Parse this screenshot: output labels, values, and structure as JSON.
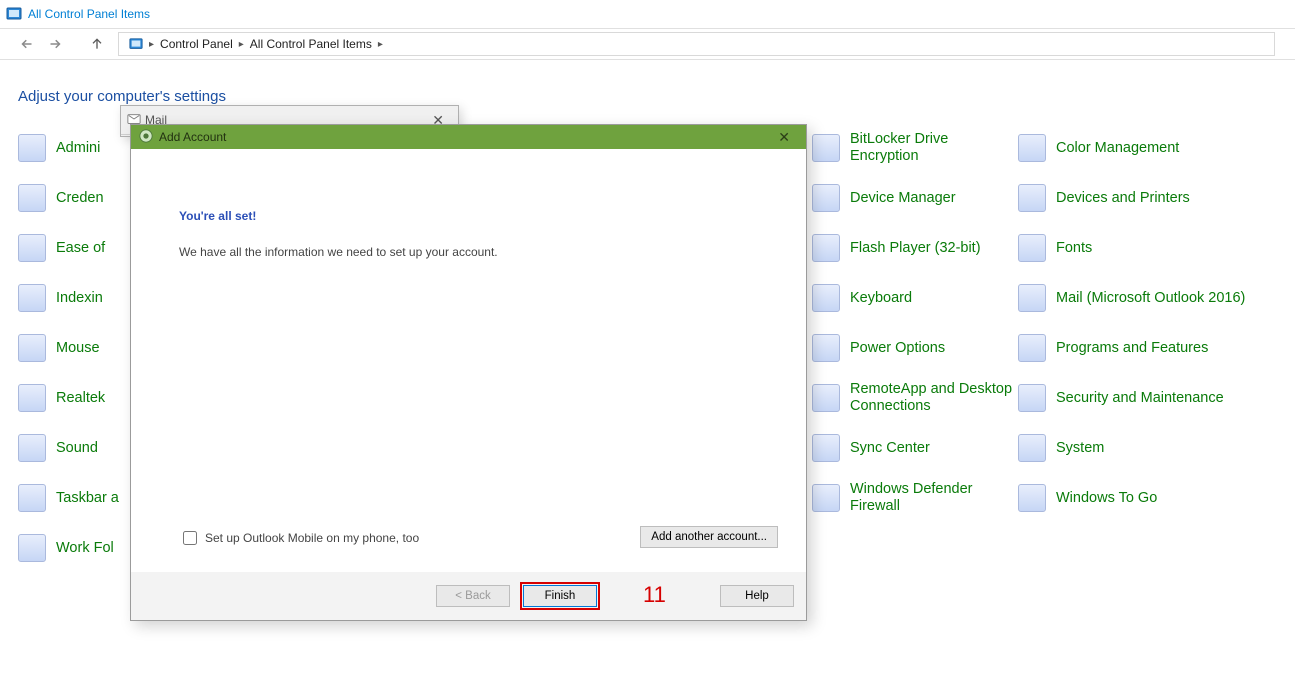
{
  "window": {
    "title": "All Control Panel Items"
  },
  "breadcrumb": {
    "segments": [
      "Control Panel",
      "All Control Panel Items"
    ]
  },
  "heading": "Adjust your computer's settings",
  "columns": {
    "c1": [
      {
        "name": "administrative-tools",
        "label": "Admini"
      },
      {
        "name": "credential-manager",
        "label": "Creden"
      },
      {
        "name": "ease-of-access",
        "label": "Ease of"
      },
      {
        "name": "indexing-options",
        "label": "Indexin"
      },
      {
        "name": "mouse",
        "label": "Mouse"
      },
      {
        "name": "realtek-audio",
        "label": "Realtek"
      },
      {
        "name": "sound",
        "label": "Sound"
      },
      {
        "name": "taskbar-and-navigation",
        "label": "Taskbar a"
      },
      {
        "name": "work-folders",
        "label": "Work Fol"
      }
    ],
    "c4": [
      {
        "name": "bitlocker",
        "label": "BitLocker Drive Encryption"
      },
      {
        "name": "device-manager",
        "label": "Device Manager"
      },
      {
        "name": "flash-player",
        "label": "Flash Player (32-bit)"
      },
      {
        "name": "keyboard",
        "label": "Keyboard"
      },
      {
        "name": "power-options",
        "label": "Power Options"
      },
      {
        "name": "remoteapp",
        "label": "RemoteApp and Desktop Connections"
      },
      {
        "name": "sync-center",
        "label": "Sync Center"
      },
      {
        "name": "windows-defender-firewall",
        "label": "Windows Defender Firewall"
      }
    ],
    "c5": [
      {
        "name": "color-management",
        "label": "Color Management"
      },
      {
        "name": "devices-and-printers",
        "label": "Devices and Printers"
      },
      {
        "name": "fonts",
        "label": "Fonts"
      },
      {
        "name": "mail-outlook-2016",
        "label": "Mail (Microsoft Outlook 2016)"
      },
      {
        "name": "programs-and-features",
        "label": "Programs and Features"
      },
      {
        "name": "security-and-maintenance",
        "label": "Security and Maintenance"
      },
      {
        "name": "system",
        "label": "System"
      },
      {
        "name": "windows-to-go",
        "label": "Windows To Go"
      }
    ]
  },
  "mail_window": {
    "title": "Mail"
  },
  "dialog": {
    "title": "Add Account",
    "headline": "You're all set!",
    "subtext": "We have all the information we need to set up your account.",
    "checkbox_label": "Set up Outlook Mobile on my phone, too",
    "add_another": "Add another account...",
    "back": "< Back",
    "finish": "Finish",
    "help": "Help"
  },
  "annotation": {
    "number": "11"
  }
}
